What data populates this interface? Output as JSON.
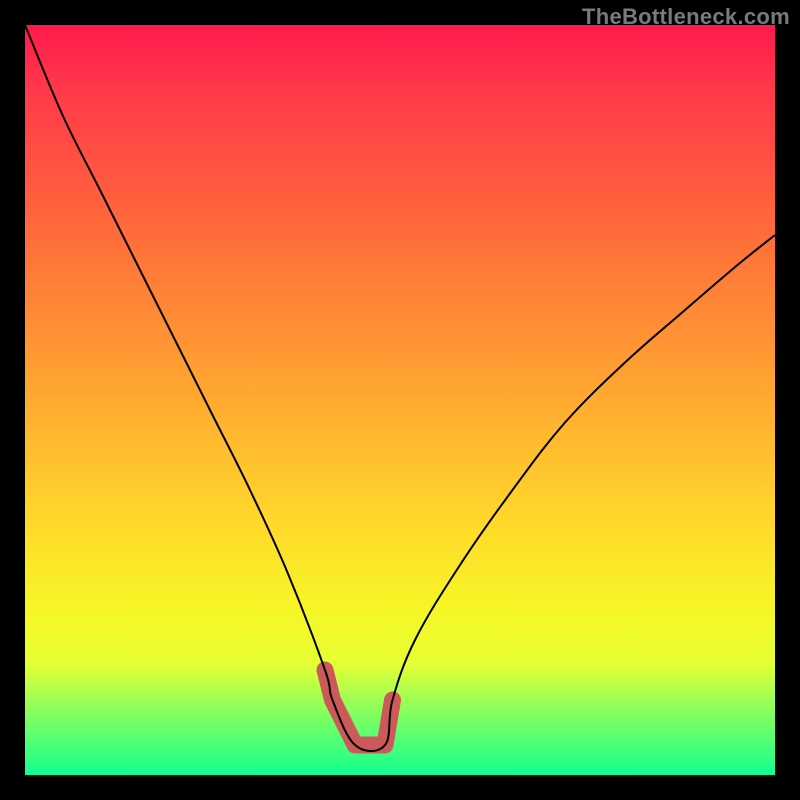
{
  "watermark": "TheBottleneck.com",
  "chart_data": {
    "type": "line",
    "title": "",
    "xlabel": "",
    "ylabel": "",
    "xlim": [
      0,
      100
    ],
    "ylim": [
      0,
      100
    ],
    "background": "rainbow-gradient (red top → green bottom)",
    "note": "V-shaped bottleneck curve. X axis is an implicit parameter sweep (no ticks shown). Y is bottleneck magnitude (no ticks shown). Lower is better. Valley region highlighted in muted red.",
    "series": [
      {
        "name": "bottleneck-curve",
        "x": [
          0,
          5,
          10,
          15,
          20,
          25,
          30,
          35,
          40,
          41,
          44,
          48,
          49,
          52,
          58,
          65,
          72,
          80,
          88,
          95,
          100
        ],
        "values": [
          100,
          88,
          78,
          68,
          58,
          48,
          38,
          27,
          14,
          10,
          4,
          4,
          10,
          18,
          28,
          38,
          47,
          55,
          62,
          68,
          72
        ]
      }
    ],
    "highlight": {
      "name": "optimal-valley",
      "x": [
        40,
        41,
        44,
        48,
        49
      ],
      "values": [
        14,
        10,
        4,
        4,
        10
      ]
    }
  }
}
